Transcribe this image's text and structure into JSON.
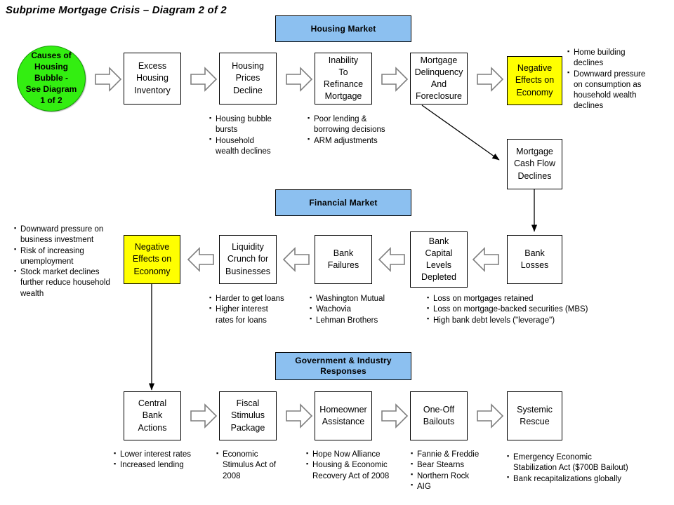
{
  "title": "Subprime Mortgage Crisis – Diagram 2 of 2",
  "banners": {
    "housing_market": "Housing Market",
    "financial_market": "Financial Market",
    "government_industry": "Government & Industry\nResponses"
  },
  "start_node": {
    "label": "Causes of\nHousing\nBubble -\nSee Diagram\n1 of 2",
    "color": "#33ee11"
  },
  "colors": {
    "banner_fill": "#8cc0f0",
    "negative_effect_fill": "#ffff00",
    "box_fill": "#ffffff",
    "stroke": "#000000",
    "arrow_stroke": "#7f7f7f"
  },
  "rows": {
    "housing_market": {
      "nodes": [
        {
          "label": "Excess\nHousing\nInventory"
        },
        {
          "label": "Housing\nPrices\nDecline"
        },
        {
          "label": "Inability\nTo\nRefinance\nMortgage"
        },
        {
          "label": "Mortgage\nDelinquency\nAnd\nForeclosure"
        },
        {
          "label": "Negative\nEffects on\nEconomy",
          "highlight": "yellow"
        }
      ],
      "notes": {
        "housing_prices_decline": [
          "Housing bubble\nbursts",
          "Household\nwealth declines"
        ],
        "inability_to_refinance": [
          "Poor lending &\nborrowing decisions",
          "ARM adjustments"
        ],
        "negative_effects_economy": [
          "Home building\ndeclines",
          "Downward pressure\non consumption as\nhousehold wealth\ndeclines"
        ]
      }
    },
    "bridge": {
      "nodes": [
        {
          "label": "Mortgage\nCash Flow\nDeclines"
        }
      ]
    },
    "financial_market": {
      "nodes": [
        {
          "label": "Negative\nEffects on\nEconomy",
          "highlight": "yellow"
        },
        {
          "label": "Liquidity\nCrunch for\nBusinesses"
        },
        {
          "label": "Bank\nFailures"
        },
        {
          "label": "Bank\nCapital\nLevels\nDepleted"
        },
        {
          "label": "Bank\nLosses"
        }
      ],
      "notes": {
        "negative_effects_economy": [
          "Downward pressure on\nbusiness investment",
          "Risk of increasing\nunemployment",
          "Stock market declines\nfurther reduce household\nwealth"
        ],
        "liquidity_crunch": [
          "Harder to get loans",
          "Higher interest\nrates for loans"
        ],
        "bank_failures": [
          "Washington Mutual",
          "Wachovia",
          "Lehman Brothers"
        ],
        "bank_losses": [
          "Loss on mortgages retained",
          "Loss on mortgage-backed securities (MBS)",
          "High bank debt levels (\"leverage\")"
        ]
      }
    },
    "government_industry": {
      "nodes": [
        {
          "label": "Central\nBank\nActions"
        },
        {
          "label": "Fiscal\nStimulus\nPackage"
        },
        {
          "label": "Homeowner\nAssistance"
        },
        {
          "label": "One-Off\nBailouts"
        },
        {
          "label": "Systemic\nRescue"
        }
      ],
      "notes": {
        "central_bank_actions": [
          "Lower interest rates",
          "Increased lending"
        ],
        "fiscal_stimulus": [
          "Economic\nStimulus Act of\n2008"
        ],
        "homeowner_assistance": [
          "Hope Now Alliance",
          "Housing & Economic\nRecovery Act of 2008"
        ],
        "one_off_bailouts": [
          "Fannie & Freddie",
          "Bear Stearns",
          "Northern Rock",
          "AIG"
        ],
        "systemic_rescue": [
          "Emergency Economic\nStabilization Act ($700B Bailout)",
          "Bank recapitalizations globally"
        ]
      }
    }
  }
}
